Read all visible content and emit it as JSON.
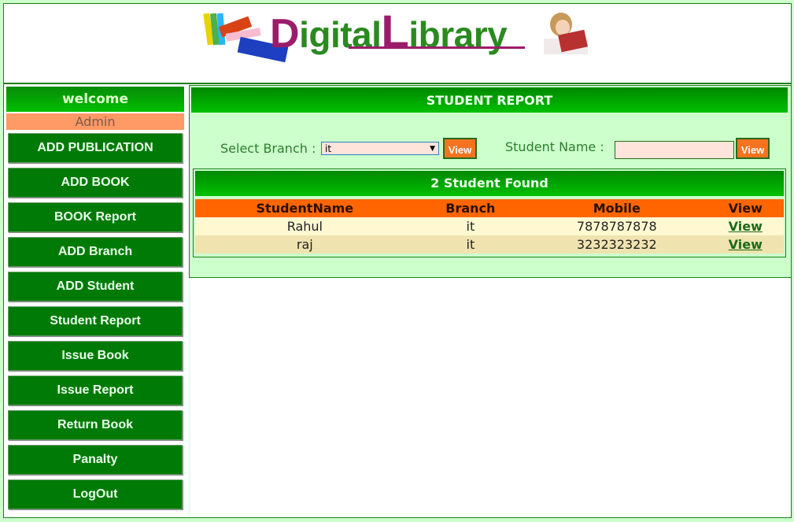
{
  "header": {
    "logo": {
      "part1_first": "D",
      "part1_rest": "igital",
      "part2_first": "L",
      "part2_rest": "ibrary"
    }
  },
  "sidebar": {
    "welcome": "welcome",
    "user": "Admin",
    "items": [
      {
        "label": "ADD PUBLICATION"
      },
      {
        "label": "ADD BOOK"
      },
      {
        "label": "BOOK Report"
      },
      {
        "label": "ADD Branch"
      },
      {
        "label": "ADD Student"
      },
      {
        "label": "Student Report"
      },
      {
        "label": "Issue Book"
      },
      {
        "label": "Issue Report"
      },
      {
        "label": "Return Book"
      },
      {
        "label": "Panalty"
      },
      {
        "label": "LogOut"
      }
    ]
  },
  "main": {
    "title": "STUDENT REPORT",
    "branch_label": "Select Branch :",
    "branch_selected": "it",
    "branch_view": "View",
    "name_label": "Student Name :",
    "name_value": "",
    "name_view": "View",
    "results": {
      "title": "2 Student Found",
      "columns": [
        "StudentName",
        "Branch",
        "Mobile",
        "View"
      ],
      "rows": [
        {
          "name": "Rahul",
          "branch": "it",
          "mobile": "7878787878",
          "view": "View"
        },
        {
          "name": "raj",
          "branch": "it",
          "mobile": "3232323232",
          "view": "View"
        }
      ]
    }
  }
}
